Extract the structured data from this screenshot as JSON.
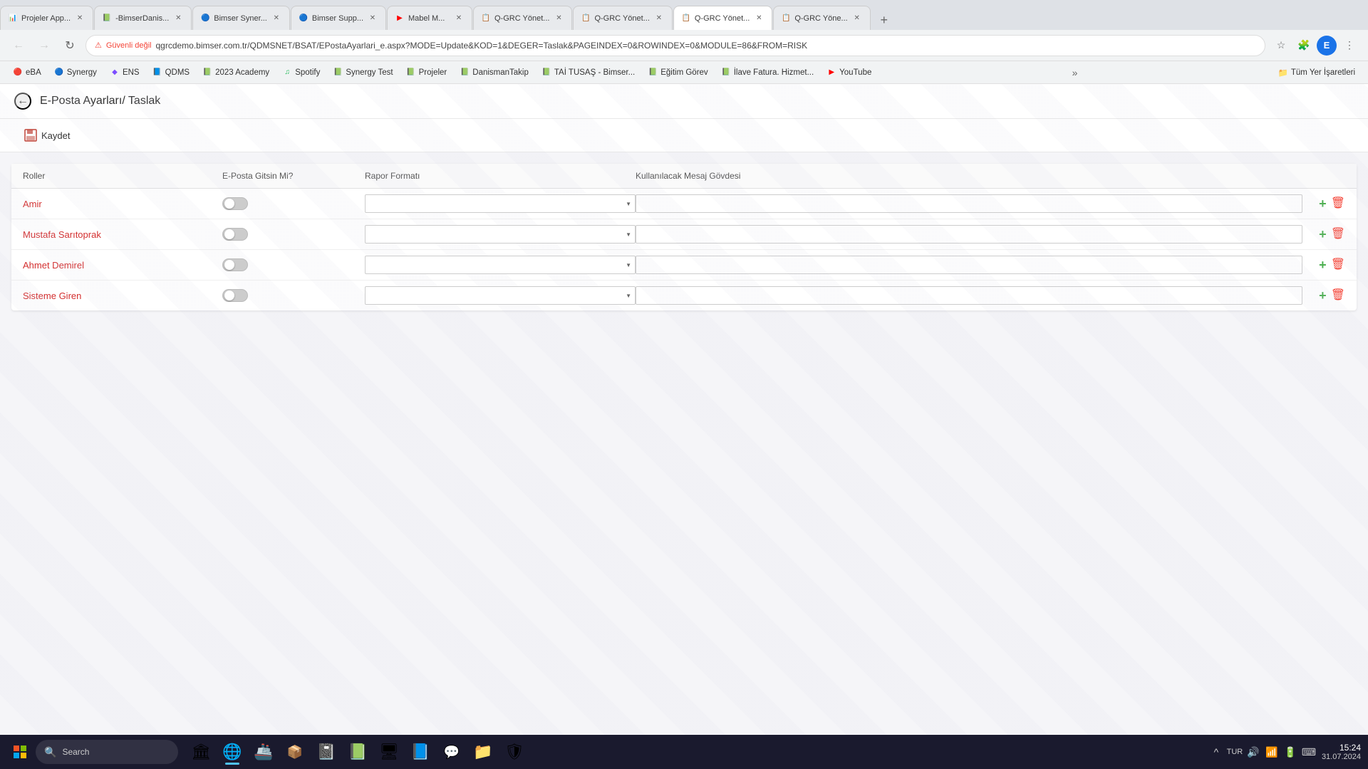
{
  "browser": {
    "tabs": [
      {
        "id": "t1",
        "favicon": "📊",
        "title": "Projeler App...",
        "active": false,
        "closable": true
      },
      {
        "id": "t2",
        "favicon": "📗",
        "title": "-BimserDanis...",
        "active": false,
        "closable": true
      },
      {
        "id": "t3",
        "favicon": "📘",
        "title": "Bimser Syner...",
        "active": false,
        "closable": true
      },
      {
        "id": "t4",
        "favicon": "📘",
        "title": "Bimser Supp...",
        "active": false,
        "closable": true
      },
      {
        "id": "t5",
        "favicon": "▶",
        "title": "Mabel M...",
        "active": false,
        "closable": true
      },
      {
        "id": "t6",
        "favicon": "📋",
        "title": "Q-GRC Yönet...",
        "active": false,
        "closable": true
      },
      {
        "id": "t7",
        "favicon": "📋",
        "title": "Q-GRC Yönet...",
        "active": false,
        "closable": true
      },
      {
        "id": "t8",
        "favicon": "📋",
        "title": "Q-GRC Yönet...",
        "active": true,
        "closable": true
      },
      {
        "id": "t9",
        "favicon": "📋",
        "title": "Q-GRC Yöne...",
        "active": false,
        "closable": true
      }
    ],
    "address": {
      "security_label": "Güvenli değil",
      "url": "qgrcdemo.bimser.com.tr/QDMSNET/BSAT/EPostaAyarlari_e.aspx?MODE=Update&KOD=1&DEGER=Taslak&PAGEINDEX=0&ROWINDEX=0&MODULE=86&FROM=RISK"
    },
    "bookmarks": [
      {
        "id": "b1",
        "favicon": "🔴",
        "label": "eBA"
      },
      {
        "id": "b2",
        "favicon": "🔵",
        "label": "Synergy"
      },
      {
        "id": "b3",
        "favicon": "💜",
        "label": "ENS"
      },
      {
        "id": "b4",
        "favicon": "🔵",
        "label": "QDMS"
      },
      {
        "id": "b5",
        "favicon": "📗",
        "label": "2023 Academy"
      },
      {
        "id": "b6",
        "favicon": "🟢",
        "label": "Spotify"
      },
      {
        "id": "b7",
        "favicon": "📗",
        "label": "Synergy Test"
      },
      {
        "id": "b8",
        "favicon": "📗",
        "label": "Projeler"
      },
      {
        "id": "b9",
        "favicon": "📗",
        "label": "DanismanTakip"
      },
      {
        "id": "b10",
        "favicon": "📗",
        "label": "TAİ TUSAŞ - Bimser..."
      },
      {
        "id": "b11",
        "favicon": "📗",
        "label": "Eğitim Görev"
      },
      {
        "id": "b12",
        "favicon": "📗",
        "label": "İlave Fatura. Hizmet..."
      },
      {
        "id": "b13",
        "favicon": "▶",
        "label": "YouTube"
      }
    ],
    "bookmark_folder": "Tüm Yer İşaretleri"
  },
  "page": {
    "back_label": "←",
    "title": "E-Posta Ayarları/ Taslak",
    "toolbar": {
      "save_label": "Kaydet"
    },
    "table": {
      "columns": {
        "roller": "Roller",
        "eposta": "E-Posta Gitsin Mi?",
        "rapor": "Rapor Formatı",
        "mesaj": "Kullanılacak Mesaj Gövdesi"
      },
      "rows": [
        {
          "id": "r1",
          "roller": "Amir",
          "toggle": false,
          "rapor": "",
          "mesaj": ""
        },
        {
          "id": "r2",
          "roller": "Mustafa Sarıtoprak",
          "toggle": false,
          "rapor": "",
          "mesaj": ""
        },
        {
          "id": "r3",
          "roller": "Ahmet Demirel",
          "toggle": false,
          "rapor": "",
          "mesaj": ""
        },
        {
          "id": "r4",
          "roller": "Sisteme Giren",
          "toggle": false,
          "rapor": "",
          "mesaj": ""
        }
      ]
    }
  },
  "taskbar": {
    "search_placeholder": "Search",
    "apps": [
      {
        "id": "a1",
        "icon": "⊞",
        "label": "Start"
      },
      {
        "id": "a2",
        "icon": "🏛",
        "label": "File Explorer",
        "active": false
      },
      {
        "id": "a3",
        "icon": "🌐",
        "label": "Chrome",
        "active": true
      },
      {
        "id": "a4",
        "icon": "✉",
        "label": "Outlook",
        "active": true
      },
      {
        "id": "a5",
        "icon": "📓",
        "label": "OneNote",
        "active": true
      },
      {
        "id": "a6",
        "icon": "📗",
        "label": "Excel",
        "active": true
      },
      {
        "id": "a7",
        "icon": "🖥",
        "label": "Terminal",
        "active": false
      },
      {
        "id": "a8",
        "icon": "📘",
        "label": "Word",
        "active": true
      },
      {
        "id": "a9",
        "icon": "💬",
        "label": "Teams",
        "active": true
      },
      {
        "id": "a10",
        "icon": "📁",
        "label": "Files",
        "active": false
      },
      {
        "id": "a11",
        "icon": "🛡",
        "label": "Security",
        "active": false
      }
    ],
    "language": "TUR",
    "time": "15:24",
    "date": "31.07.2024"
  }
}
